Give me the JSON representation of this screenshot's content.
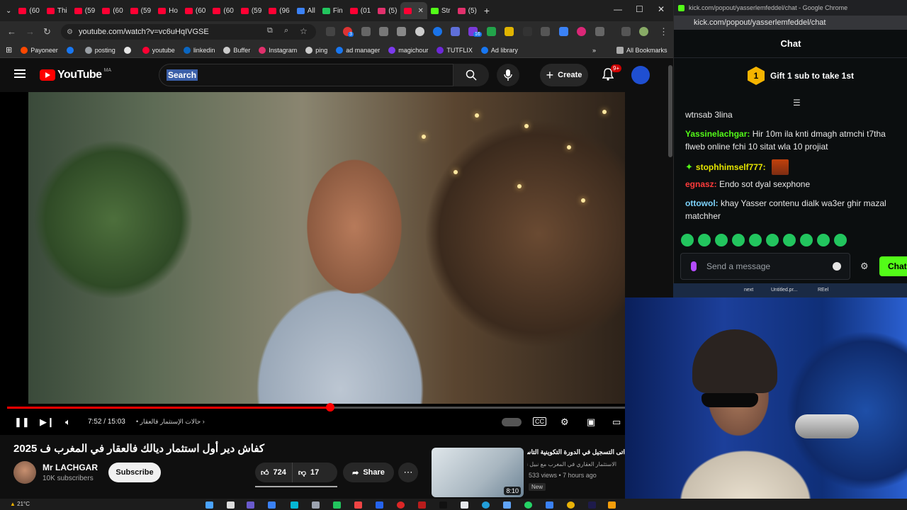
{
  "browser": {
    "tabs": [
      {
        "label": "(60",
        "color": "#ff0033"
      },
      {
        "label": "Thi",
        "color": "#ff0033"
      },
      {
        "label": "(59",
        "color": "#ff0033"
      },
      {
        "label": "(60",
        "color": "#ff0033"
      },
      {
        "label": "(59",
        "color": "#ff0033"
      },
      {
        "label": "Ho",
        "color": "#ff0033"
      },
      {
        "label": "(60",
        "color": "#ff0033"
      },
      {
        "label": "(60",
        "color": "#ff0033"
      },
      {
        "label": "(59",
        "color": "#ff0033"
      },
      {
        "label": "(96",
        "color": "#ff0033"
      },
      {
        "label": "All",
        "color": "#3b82f6"
      },
      {
        "label": "Fin",
        "color": "#22c55e"
      },
      {
        "label": "(01",
        "color": "#ff0033"
      },
      {
        "label": "(5)",
        "color": "#e1306c"
      },
      {
        "label": "",
        "color": "#ff0033"
      },
      {
        "label": "Str",
        "color": "#53fc18"
      },
      {
        "label": "(5)",
        "color": "#e1306c"
      }
    ],
    "url": "youtube.com/watch?v=vc6uHqIVGSE",
    "bookmarks": [
      {
        "label": "Payoneer",
        "color": "#ff4800"
      },
      {
        "label": "",
        "color": "#1877f2"
      },
      {
        "label": "posting",
        "color": "#9aa0a6"
      },
      {
        "label": "",
        "color": "#e6e6e6"
      },
      {
        "label": "youtube",
        "color": "#ff0033"
      },
      {
        "label": "linkedin",
        "color": "#0a66c2"
      },
      {
        "label": "Buffer",
        "color": "#cccccc"
      },
      {
        "label": "Instagram",
        "color": "#e1306c"
      },
      {
        "label": "ping",
        "color": "#cccccc"
      },
      {
        "label": "ad manager",
        "color": "#1877f2"
      },
      {
        "label": "magichour",
        "color": "#7c3aed"
      },
      {
        "label": "TUTFLIX",
        "color": "#6d28d9"
      },
      {
        "label": "Ad library",
        "color": "#1877f2"
      }
    ],
    "all_bookmarks_label": "All Bookmarks",
    "extension_badges": {
      "first": "3",
      "second": "16"
    }
  },
  "youtube": {
    "logo_text": "YouTube",
    "country_code": "MA",
    "search_placeholder": "Search",
    "create_label": "Create",
    "notifications_badge": "9+",
    "player": {
      "current_time": "7:52",
      "duration": "15:03",
      "time_separator": "/",
      "progress_fraction": 0.5226,
      "chapter_label": "حالات الإستثمار فالعقار"
    },
    "video": {
      "title": "كفاش دير أول استثمار ديالك فالعقار في المغرب ف 2025",
      "channel_name": "Mr LACHGAR",
      "subscribers": "10K subscribers",
      "subscribe_label": "Subscribe",
      "likes": "724",
      "dislikes": "17",
      "share_label": "Share"
    },
    "recommended": {
      "title": "اتى التسجيل في الدورة التكوينية التاسعة",
      "channel": "الاستثمار العقاري في المغرب مع نبيل نور",
      "meta": "533 views • 7 hours ago",
      "badge": "New",
      "duration": "8:10"
    }
  },
  "kick": {
    "window_title": "kick.com/popout/yasserlemfeddel/chat - Google Chrome",
    "url": "kick.com/popout/yasserlemfeddel/chat",
    "chat_header": "Chat",
    "gift_badge_number": "1",
    "gift_text": "Gift 1 sub to take 1st",
    "messages": [
      {
        "user": "",
        "user_color": "#e8e8e8",
        "text": "wtnsab 3lina"
      },
      {
        "user": "Yassinelachgar:",
        "user_color": "#53fc18",
        "text": "Hir 10m ila knti dmagh atmchi t7tha flweb online fchi 10 sitat wla 10 projiat"
      },
      {
        "user": "stophhimself777:",
        "user_color": "#e5e500",
        "text": ""
      },
      {
        "user": "egnasz:",
        "user_color": "#ff3b3b",
        "text": "Endo sot dyal sexphone"
      },
      {
        "user": "ottowol:",
        "user_color": "#7dd3fc",
        "text": "khay Yasser contenu dialk wa3er ghir mazal matchher"
      }
    ],
    "input_placeholder": "Send a message",
    "send_label": "Chat"
  },
  "desktop": {
    "labels": [
      "next",
      "Untitled.pr...",
      "REel"
    ]
  },
  "taskbar": {
    "weather": "21°C"
  }
}
